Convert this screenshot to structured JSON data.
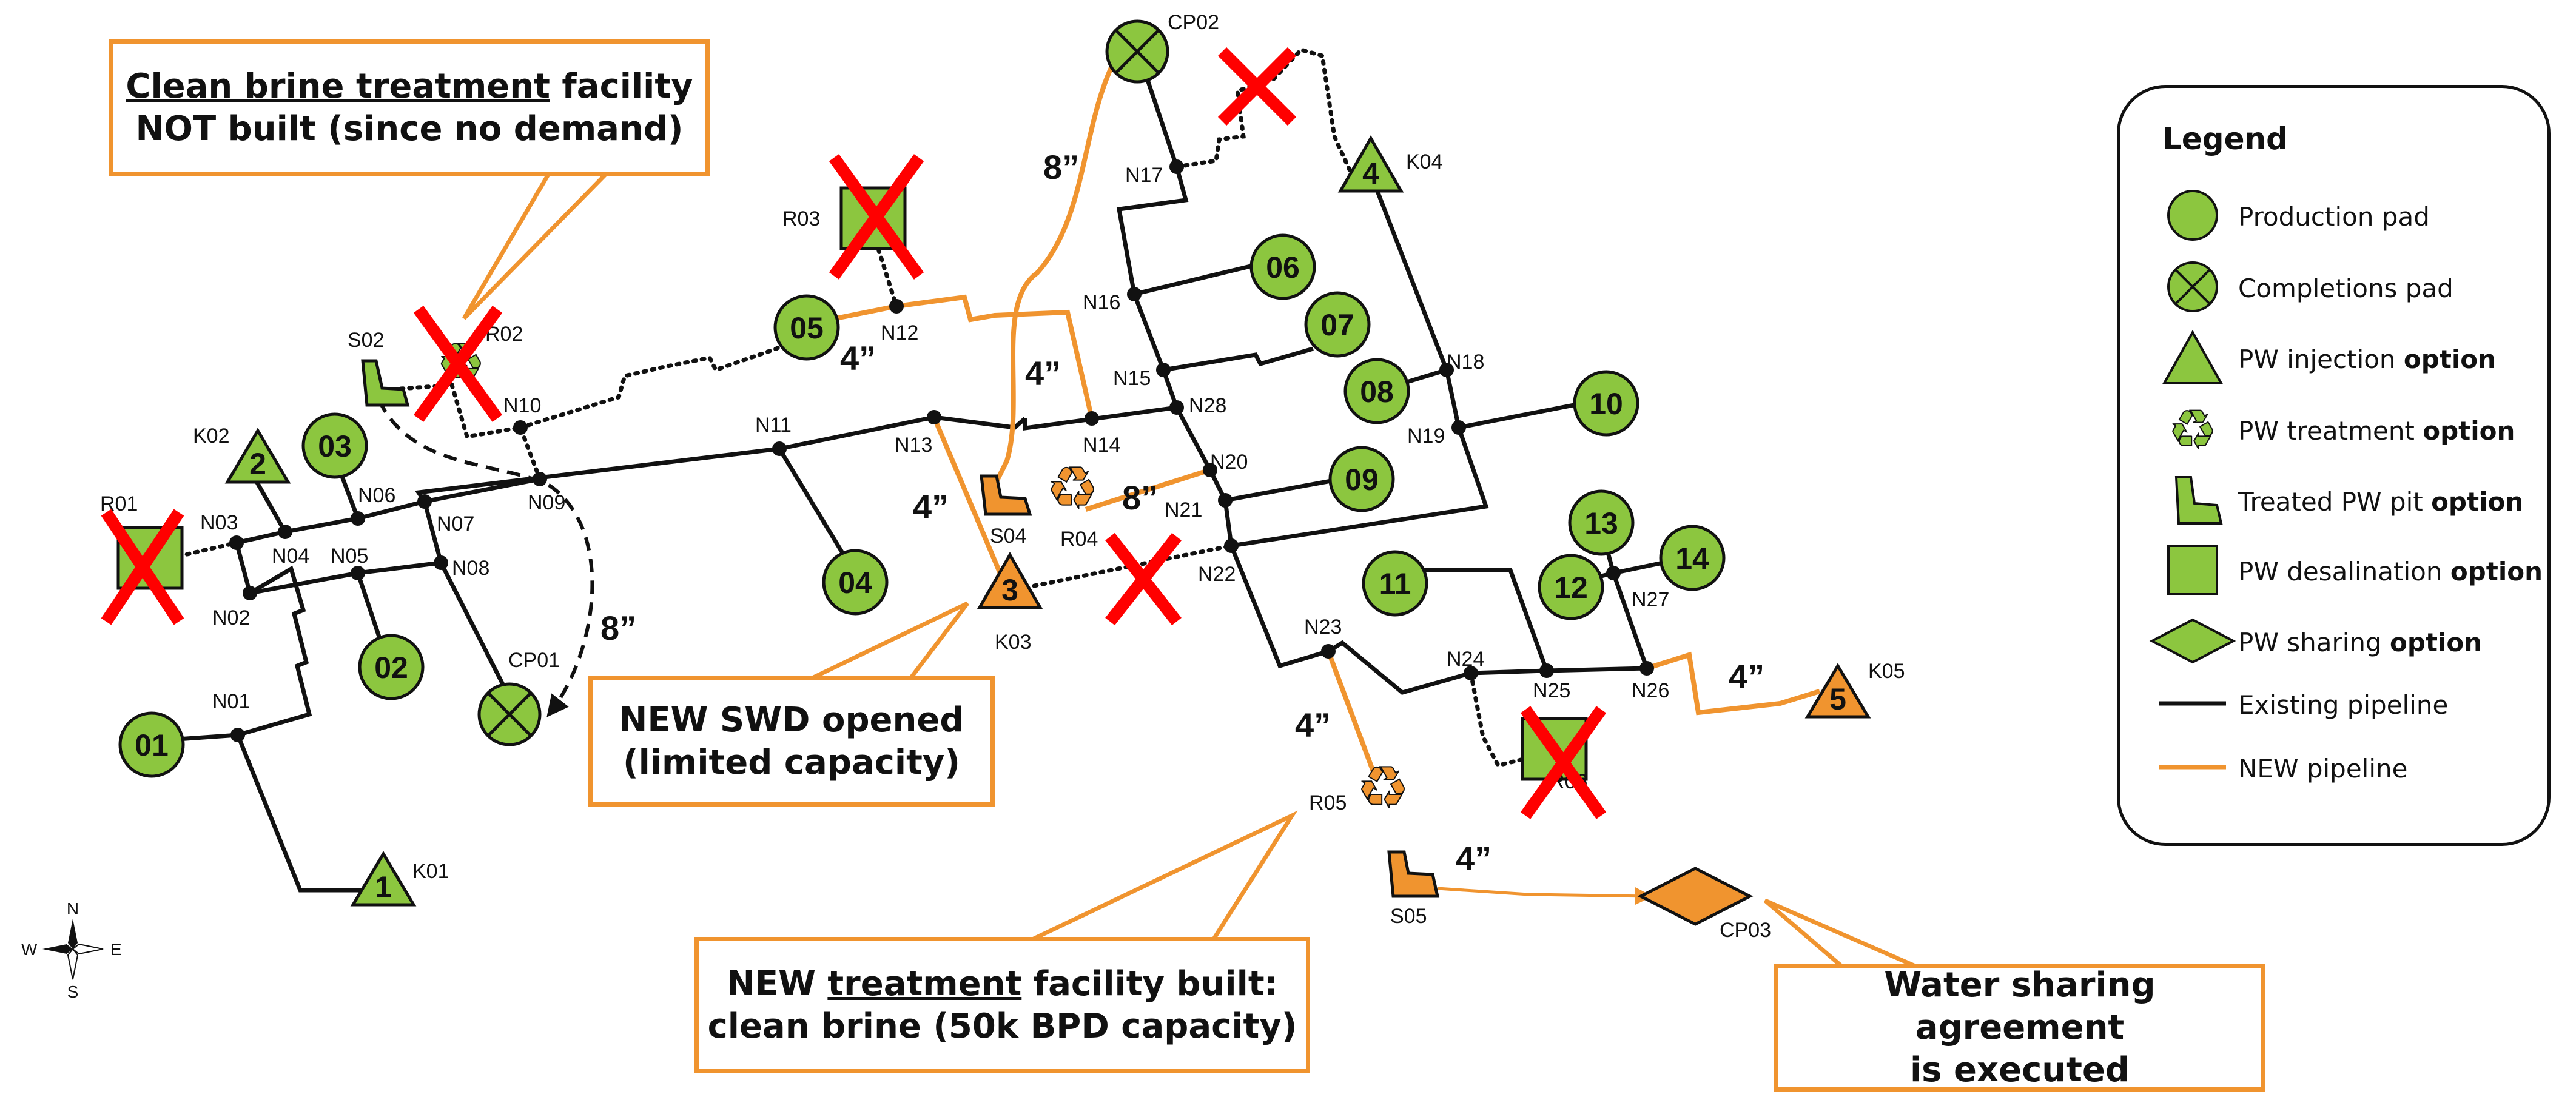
{
  "nodes": {
    "N01": "N01",
    "N02": "N02",
    "N03": "N03",
    "N04": "N04",
    "N05": "N05",
    "N06": "N06",
    "N07": "N07",
    "N08": "N08",
    "N09": "N09",
    "N10": "N10",
    "N11": "N11",
    "N12": "N12",
    "N13": "N13",
    "N14": "N14",
    "N15": "N15",
    "N16": "N16",
    "N17": "N17",
    "N18": "N18",
    "N19": "N19",
    "N20": "N20",
    "N21": "N21",
    "N22": "N22",
    "N23": "N23",
    "N24": "N24",
    "N25": "N25",
    "N26": "N26",
    "N27": "N27",
    "N28": "N28"
  },
  "pads": {
    "p01": "01",
    "p02": "02",
    "p03": "03",
    "p04": "04",
    "p05": "05",
    "p06": "06",
    "p07": "07",
    "p08": "08",
    "p09": "09",
    "p10": "10",
    "p11": "11",
    "p12": "12",
    "p13": "13",
    "p14": "14"
  },
  "completions": {
    "CP01": "CP01",
    "CP02": "CP02",
    "CP03": "CP03"
  },
  "injection": {
    "K01": {
      "label": "K01",
      "num": "1"
    },
    "K02": {
      "label": "K02",
      "num": "2"
    },
    "K03": {
      "label": "K03",
      "num": "3"
    },
    "K04": {
      "label": "K04",
      "num": "4"
    },
    "K05": {
      "label": "K05",
      "num": "5"
    }
  },
  "treatment": {
    "R02": "R02",
    "R04": "R04",
    "R05": "R05"
  },
  "desalination": {
    "R01": "R01",
    "R03": "R03",
    "R06": "R06"
  },
  "pits": {
    "S02": "S02",
    "S04": "S04",
    "S05": "S05"
  },
  "pipe_labels": {
    "a": "8”",
    "b": "4”",
    "c": "4”",
    "d": "4”",
    "e": "8”",
    "f": "8”",
    "g": "4”",
    "h": "4”",
    "i": "4”"
  },
  "callouts": {
    "clean_brine": {
      "line1_u": "Clean brine treatment",
      "line1_rest": " facility",
      "line2": "NOT built (since no demand)"
    },
    "new_swd": {
      "line1": "NEW SWD opened",
      "line2": "(limited capacity)"
    },
    "new_treatment": {
      "line1_a": "NEW ",
      "line1_u": "treatment",
      "line1_b": " facility built:",
      "line2": "clean brine (50k BPD capacity)"
    },
    "sharing": {
      "line1": "Water sharing agreement",
      "line2": "is executed"
    }
  },
  "legend": {
    "title": "Legend",
    "production": "Production pad",
    "completions": "Completions pad",
    "injection_a": "PW injection ",
    "injection_b": "option",
    "treatment_a": "PW treatment ",
    "treatment_b": "option",
    "pit_a": "Treated PW pit ",
    "pit_b": "option",
    "desal_a": "PW desalination ",
    "desal_b": "option",
    "sharing_a": "PW sharing ",
    "sharing_b": "option",
    "existing": "Existing pipeline",
    "new": "NEW pipeline"
  },
  "compass": {
    "n": "N",
    "s": "S",
    "e": "E",
    "w": "W"
  },
  "colors": {
    "pad_green": "#8cc63f",
    "new_orange": "#f0942f",
    "existing": "#111111",
    "cross_red": "#ff0000"
  }
}
